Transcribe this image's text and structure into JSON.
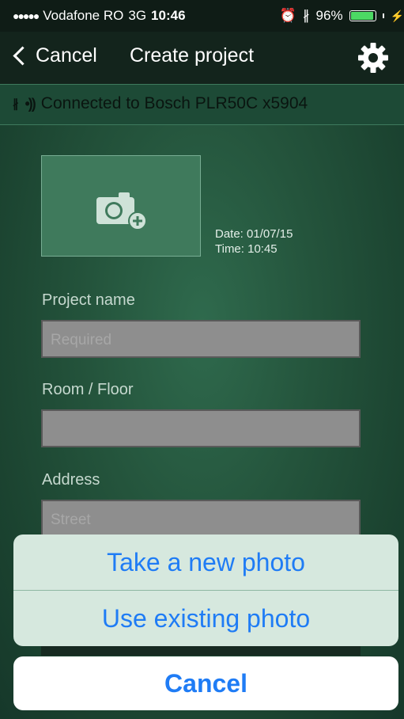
{
  "status_bar": {
    "carrier": "Vodafone RO",
    "network": "3G",
    "time": "10:46",
    "battery": "96%",
    "battery_level": 0.96
  },
  "nav": {
    "back_label": "Cancel",
    "title": "Create project"
  },
  "connection": {
    "text": "Connected to Bosch PLR50C x5904"
  },
  "photo": {
    "date_label": "Date: 01/07/15",
    "time_label": "Time:  10:45"
  },
  "form": {
    "project_name_label": "Project name",
    "project_name_placeholder": "Required",
    "room_label": "Room / Floor",
    "room_placeholder": "",
    "address_label": "Address",
    "street_placeholder": "Street"
  },
  "action_sheet": {
    "take_photo": "Take a new photo",
    "use_existing": "Use existing photo",
    "cancel": "Cancel"
  },
  "colors": {
    "accent": "#1f7cf5",
    "background": "#24543c"
  }
}
